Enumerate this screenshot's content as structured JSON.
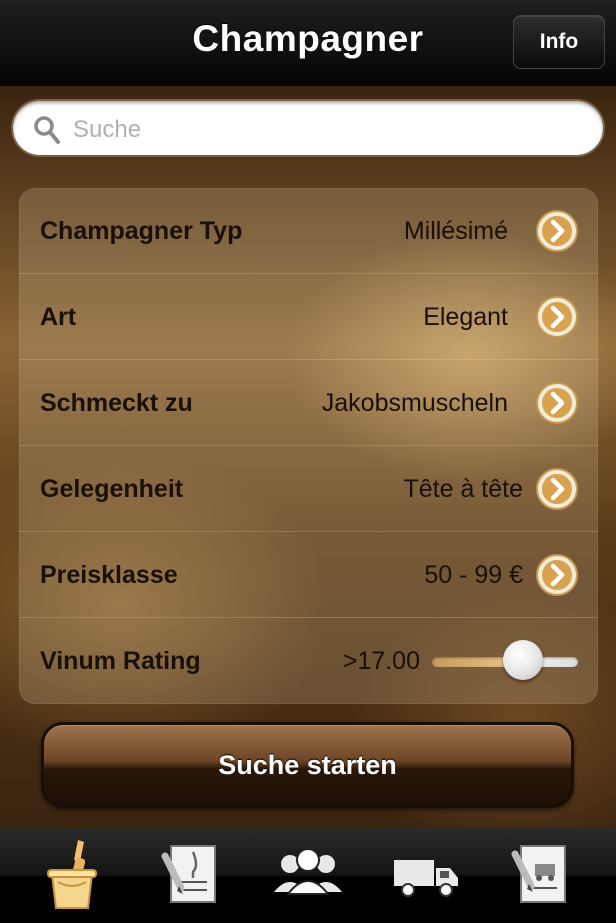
{
  "navbar": {
    "title": "Champagner",
    "info_label": "Info"
  },
  "search": {
    "placeholder": "Suche",
    "value": ""
  },
  "form": {
    "rows": [
      {
        "label": "Champagner Typ",
        "value": "Millésimé"
      },
      {
        "label": "Art",
        "value": "Elegant"
      },
      {
        "label": "Schmeckt zu",
        "value": "Jakobsmuscheln"
      },
      {
        "label": "Gelegenheit",
        "value": "Tête à tête"
      },
      {
        "label": "Preisklasse",
        "value": "50 - 99 €"
      }
    ],
    "rating": {
      "label": "Vinum Rating",
      "value": ">17.00",
      "slider_fraction": 0.62
    }
  },
  "start_button": {
    "label": "Suche starten"
  },
  "tabbar": {
    "tabs": [
      {
        "icon": "champagne-bucket-icon",
        "selected": true
      },
      {
        "icon": "tasting-notes-icon",
        "selected": false
      },
      {
        "icon": "group-icon",
        "selected": false
      },
      {
        "icon": "delivery-truck-icon",
        "selected": false
      },
      {
        "icon": "order-form-icon",
        "selected": false
      }
    ]
  },
  "colors": {
    "accent": "#e8c27a",
    "text_dark": "#1a0f05",
    "nav": "#0a0a0a"
  }
}
